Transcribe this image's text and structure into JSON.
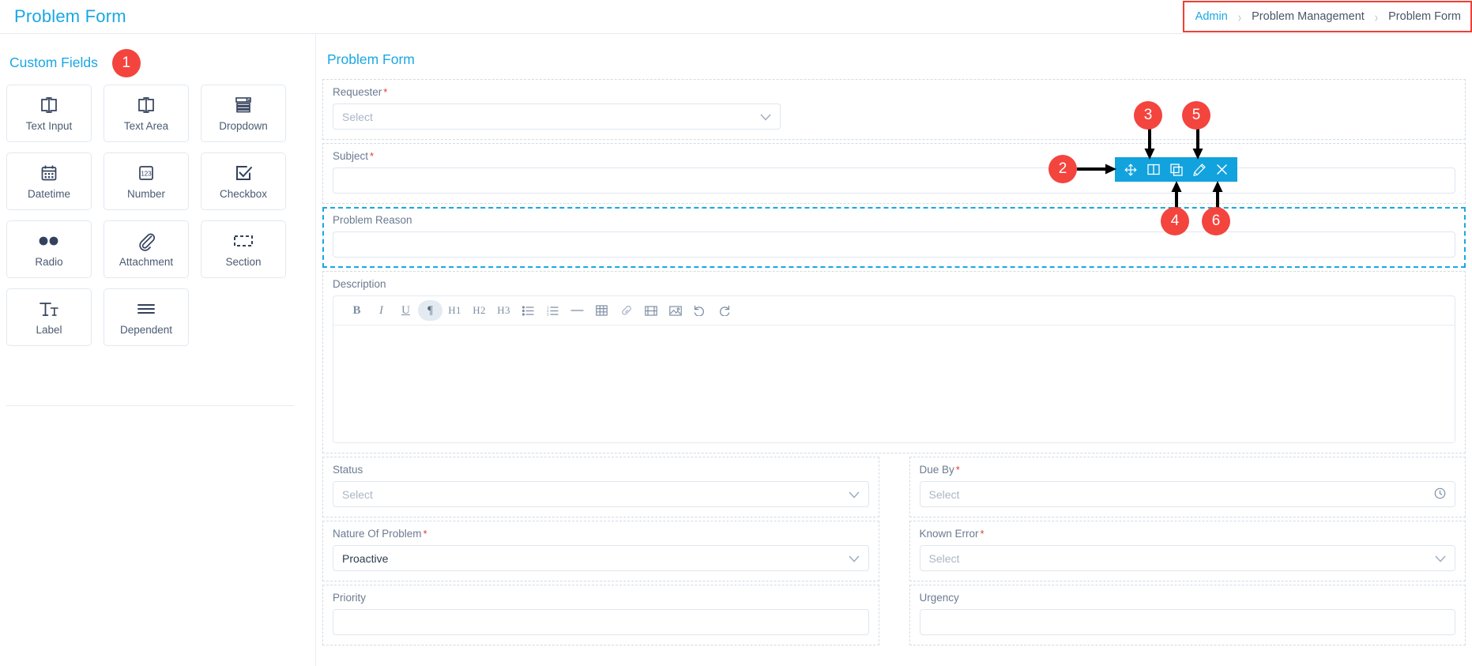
{
  "header": {
    "title": "Problem Form",
    "breadcrumb": [
      {
        "label": "Admin",
        "link": true
      },
      {
        "label": "Problem Management",
        "link": false
      },
      {
        "label": "Problem Form",
        "link": false
      }
    ],
    "breadcrumb_separator": "›",
    "highlight_color": "#ef3e36"
  },
  "palette": {
    "title": "Custom Fields",
    "badge": "1",
    "items": [
      {
        "label": "Text Input",
        "icon": "text-input-icon"
      },
      {
        "label": "Text Area",
        "icon": "text-area-icon"
      },
      {
        "label": "Dropdown",
        "icon": "dropdown-icon"
      },
      {
        "label": "Datetime",
        "icon": "calendar-icon"
      },
      {
        "label": "Number",
        "icon": "number-123-icon"
      },
      {
        "label": "Checkbox",
        "icon": "checkbox-icon"
      },
      {
        "label": "Radio",
        "icon": "radio-icon"
      },
      {
        "label": "Attachment",
        "icon": "paperclip-icon"
      },
      {
        "label": "Section",
        "icon": "section-dashed-icon"
      },
      {
        "label": "Label",
        "icon": "label-tt-icon"
      },
      {
        "label": "Dependent",
        "icon": "dependent-lines-icon"
      }
    ]
  },
  "form": {
    "title": "Problem Form",
    "accent": "#19a7e4",
    "fields": {
      "requester": {
        "label": "Requester",
        "required": true,
        "value": "Select"
      },
      "subject": {
        "label": "Subject",
        "required": true,
        "value": ""
      },
      "problem_reason": {
        "label": "Problem Reason",
        "required": false,
        "value": "",
        "selected": true
      },
      "description": {
        "label": "Description",
        "required": false,
        "value": ""
      },
      "status": {
        "label": "Status",
        "required": false,
        "value": "Select"
      },
      "due_by": {
        "label": "Due By",
        "required": true,
        "value": "Select"
      },
      "nature_of_problem": {
        "label": "Nature Of Problem",
        "required": true,
        "value": "Proactive"
      },
      "known_error": {
        "label": "Known Error",
        "required": true,
        "value": "Select"
      },
      "priority": {
        "label": "Priority",
        "required": false,
        "value": ""
      },
      "urgency": {
        "label": "Urgency",
        "required": false,
        "value": ""
      }
    },
    "editor_toolbar": [
      {
        "label": "B",
        "icon": "bold-icon",
        "active": false
      },
      {
        "label": "I",
        "icon": "italic-icon",
        "active": false
      },
      {
        "label": "U",
        "icon": "underline-icon",
        "active": false
      },
      {
        "label": "¶",
        "icon": "paragraph-icon",
        "active": true
      },
      {
        "label": "H1",
        "icon": "heading1-icon",
        "active": false
      },
      {
        "label": "H2",
        "icon": "heading2-icon",
        "active": false
      },
      {
        "label": "H3",
        "icon": "heading3-icon",
        "active": false
      },
      {
        "label": "",
        "icon": "bullet-list-icon",
        "active": false
      },
      {
        "label": "",
        "icon": "numbered-list-icon",
        "active": false
      },
      {
        "label": "",
        "icon": "horizontal-rule-icon",
        "active": false
      },
      {
        "label": "",
        "icon": "table-icon",
        "active": false
      },
      {
        "label": "",
        "icon": "link-icon",
        "active": false
      },
      {
        "label": "",
        "icon": "video-icon",
        "active": false
      },
      {
        "label": "",
        "icon": "image-icon",
        "active": false
      },
      {
        "label": "",
        "icon": "undo-icon",
        "active": false
      },
      {
        "label": "",
        "icon": "redo-icon",
        "active": false
      }
    ]
  },
  "field_toolbar": {
    "background": "#12a3de",
    "buttons": [
      {
        "name": "move",
        "icon": "move-arrows-icon"
      },
      {
        "name": "columns",
        "icon": "split-columns-icon"
      },
      {
        "name": "duplicate",
        "icon": "duplicate-icon"
      },
      {
        "name": "edit",
        "icon": "pencil-icon"
      },
      {
        "name": "remove",
        "icon": "close-x-icon"
      }
    ]
  },
  "callouts": [
    {
      "number": "2",
      "target": "field-toolbar"
    },
    {
      "number": "3",
      "target": "columns-button"
    },
    {
      "number": "4",
      "target": "duplicate-button"
    },
    {
      "number": "5",
      "target": "edit-button"
    },
    {
      "number": "6",
      "target": "remove-button"
    }
  ]
}
